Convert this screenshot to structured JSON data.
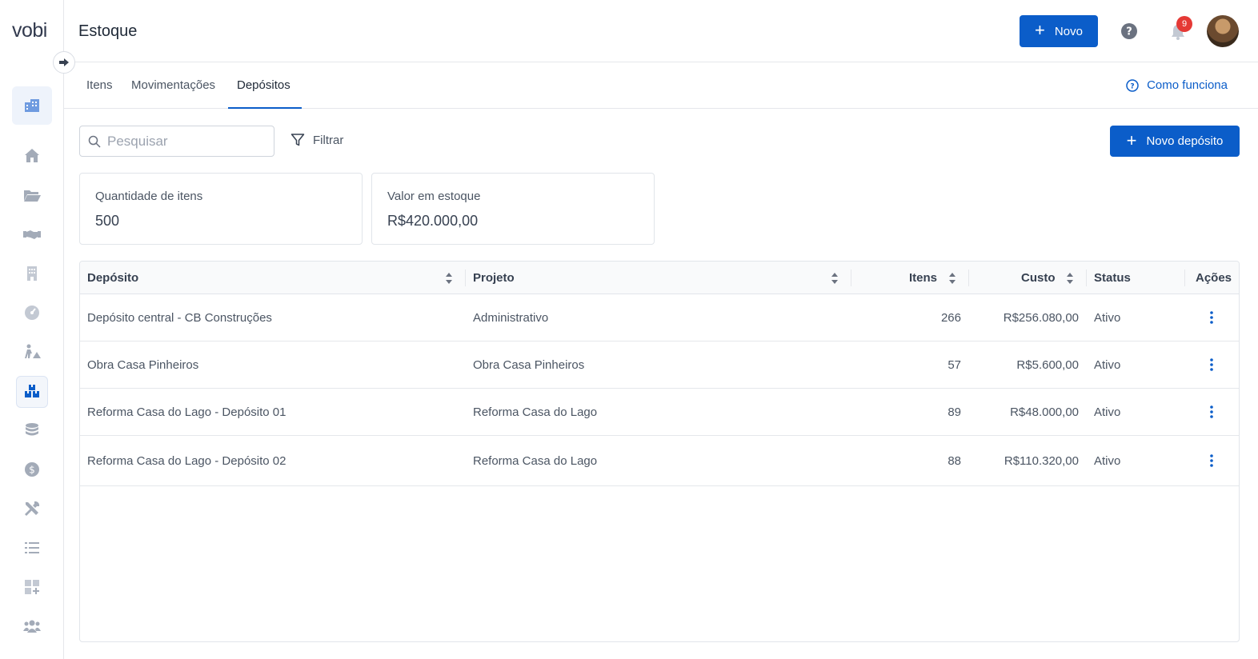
{
  "app": {
    "logo": "vobi",
    "page_title": "Estoque"
  },
  "header": {
    "new_button": "Novo",
    "notification_count": "9"
  },
  "tabs": [
    {
      "label": "Itens"
    },
    {
      "label": "Movimentações"
    },
    {
      "label": "Depósitos"
    }
  ],
  "active_tab": "Depósitos",
  "help_link": "Como funciona",
  "toolbar": {
    "search_placeholder": "Pesquisar",
    "filter_label": "Filtrar",
    "new_deposit_button": "Novo depósito"
  },
  "summary": {
    "items_label": "Quantidade de itens",
    "items_value": "500",
    "stock_label": "Valor em estoque",
    "stock_value": "R$420.000,00"
  },
  "table": {
    "columns": [
      "Depósito",
      "Projeto",
      "Itens",
      "Custo",
      "Status",
      "Ações"
    ],
    "rows": [
      {
        "deposito": "Depósito central - CB Construções",
        "projeto": "Administrativo",
        "itens": "266",
        "custo": "R$256.080,00",
        "status": "Ativo"
      },
      {
        "deposito": "Obra Casa Pinheiros",
        "projeto": "Obra Casa Pinheiros",
        "itens": "57",
        "custo": "R$5.600,00",
        "status": "Ativo"
      },
      {
        "deposito": "Reforma Casa do Lago - Depósito 01",
        "projeto": "Reforma Casa do Lago",
        "itens": "89",
        "custo": "R$48.000,00",
        "status": "Ativo"
      },
      {
        "deposito": "Reforma Casa do Lago - Depósito 02",
        "projeto": "Reforma Casa do Lago",
        "itens": "88",
        "custo": "R$110.320,00",
        "status": "Ativo"
      }
    ]
  },
  "colors": {
    "primary": "#0b5dc9",
    "badge": "#e53935",
    "icon_gray": "#a3abb8"
  },
  "sidebar_icons": [
    "buildings-icon",
    "home-icon",
    "folder-open-icon",
    "handshake-icon",
    "office-building-icon",
    "gauge-icon",
    "worker-icon",
    "boxes-icon",
    "coins-icon",
    "dollar-circle-icon",
    "tools-icon",
    "list-icon",
    "apps-add-icon",
    "users-icon"
  ]
}
